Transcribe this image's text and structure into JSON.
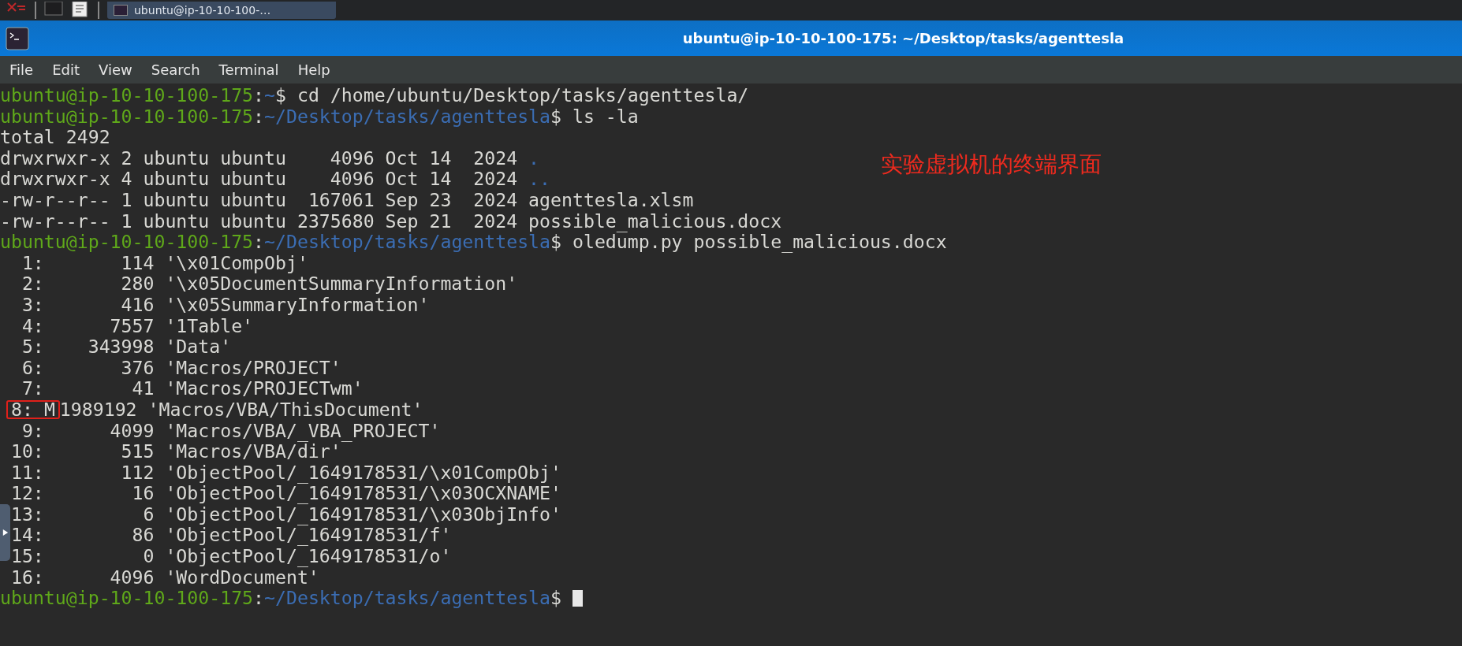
{
  "taskbar": {
    "task_button": {
      "label": "ubuntu@ip-10-10-100-…",
      "selected": true
    }
  },
  "window": {
    "title": "ubuntu@ip-10-10-100-175: ~/Desktop/tasks/agenttesla",
    "menu": [
      "File",
      "Edit",
      "View",
      "Search",
      "Terminal",
      "Help"
    ]
  },
  "terminal": {
    "lines": [
      {
        "kind": "prompt",
        "user": "ubuntu@ip-10-10-100-175",
        "sep": ":",
        "path": "~",
        "dollar": "$",
        "command": "cd /home/ubuntu/Desktop/tasks/agenttesla/"
      },
      {
        "kind": "prompt",
        "user": "ubuntu@ip-10-10-100-175",
        "sep": ":",
        "path": "~/Desktop/tasks/agenttesla",
        "dollar": "$",
        "command": "ls -la"
      },
      {
        "kind": "output",
        "text": "total 2492"
      },
      {
        "kind": "listing",
        "text": "drwxrwxr-x 2 ubuntu ubuntu    4096 Oct 14  2024",
        "entry": ".",
        "color": "#3b6db3"
      },
      {
        "kind": "listing",
        "text": "drwxrwxr-x 4 ubuntu ubuntu    4096 Oct 14  2024",
        "entry": "..",
        "color": "#3b6db3"
      },
      {
        "kind": "listing",
        "text": "-rw-r--r-- 1 ubuntu ubuntu  167061 Sep 23  2024",
        "entry": "agenttesla.xlsm"
      },
      {
        "kind": "listing",
        "text": "-rw-r--r-- 1 ubuntu ubuntu 2375680 Sep 21  2024",
        "entry": "possible_malicious.docx"
      },
      {
        "kind": "prompt",
        "user": "ubuntu@ip-10-10-100-175",
        "sep": ":",
        "path": "~/Desktop/tasks/agenttesla",
        "dollar": "$",
        "command": "oledump.py possible_malicious.docx"
      },
      {
        "kind": "output",
        "text": "  1:       114 '\\x01CompObj'"
      },
      {
        "kind": "output",
        "text": "  2:       280 '\\x05DocumentSummaryInformation'"
      },
      {
        "kind": "output",
        "text": "  3:       416 '\\x05SummaryInformation'"
      },
      {
        "kind": "output",
        "text": "  4:      7557 '1Table'"
      },
      {
        "kind": "output",
        "text": "  5:    343998 'Data'"
      },
      {
        "kind": "output",
        "text": "  6:       376 'Macros/PROJECT'"
      },
      {
        "kind": "output",
        "text": "  7:        41 'Macros/PROJECTwm'"
      },
      {
        "kind": "boxed",
        "boxed": "8: M",
        "text": "1989192 'Macros/VBA/ThisDocument'"
      },
      {
        "kind": "output",
        "text": "  9:      4099 'Macros/VBA/_VBA_PROJECT'"
      },
      {
        "kind": "output",
        "text": " 10:       515 'Macros/VBA/dir'"
      },
      {
        "kind": "output",
        "text": " 11:       112 'ObjectPool/_1649178531/\\x01CompObj'"
      },
      {
        "kind": "output",
        "text": " 12:        16 'ObjectPool/_1649178531/\\x03OCXNAME'"
      },
      {
        "kind": "output",
        "text": " 13:         6 'ObjectPool/_1649178531/\\x03ObjInfo'"
      },
      {
        "kind": "output",
        "text": " 14:        86 'ObjectPool/_1649178531/f'"
      },
      {
        "kind": "output",
        "text": " 15:         0 'ObjectPool/_1649178531/o'"
      },
      {
        "kind": "output",
        "text": " 16:      4096 'WordDocument'"
      },
      {
        "kind": "prompt",
        "user": "ubuntu@ip-10-10-100-175",
        "sep": ":",
        "path": "~/Desktop/tasks/agenttesla",
        "dollar": "$",
        "cursor": true
      }
    ]
  },
  "annotation": {
    "text": "实验虚拟机的终端界面"
  }
}
